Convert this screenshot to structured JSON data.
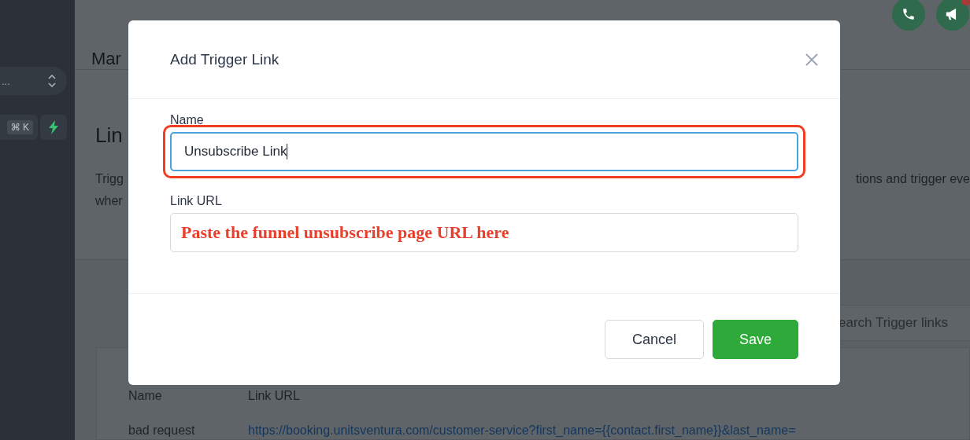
{
  "sidebar": {
    "switcher": {
      "text": "..."
    },
    "shortcut": {
      "keys": "⌘ K"
    }
  },
  "header": {
    "title": "Mar",
    "notification_badge": true
  },
  "section": {
    "title": "Lin",
    "description_lines": [
      "Trigg",
      "wher"
    ],
    "description_right": "tions and trigger eve"
  },
  "search": {
    "placeholder": "earch Trigger links"
  },
  "table": {
    "columns": [
      "Name",
      "Link URL"
    ],
    "rows": [
      {
        "name": "bad request",
        "url": "https://booking.unitsventura.com/customer-service?first_name={{contact.first_name}}&last_name="
      }
    ]
  },
  "dialog": {
    "title": "Add Trigger Link",
    "fields": [
      {
        "label": "Name",
        "value": "Unsubscribe Link",
        "focused": true,
        "highlighted": true
      },
      {
        "label": "Link URL",
        "annotation": "Paste the funnel unsubscribe page URL here",
        "focused": false,
        "highlighted": false
      }
    ],
    "buttons": [
      {
        "label": "Cancel",
        "kind": "secondary"
      },
      {
        "label": "Save",
        "kind": "primary"
      }
    ]
  }
}
